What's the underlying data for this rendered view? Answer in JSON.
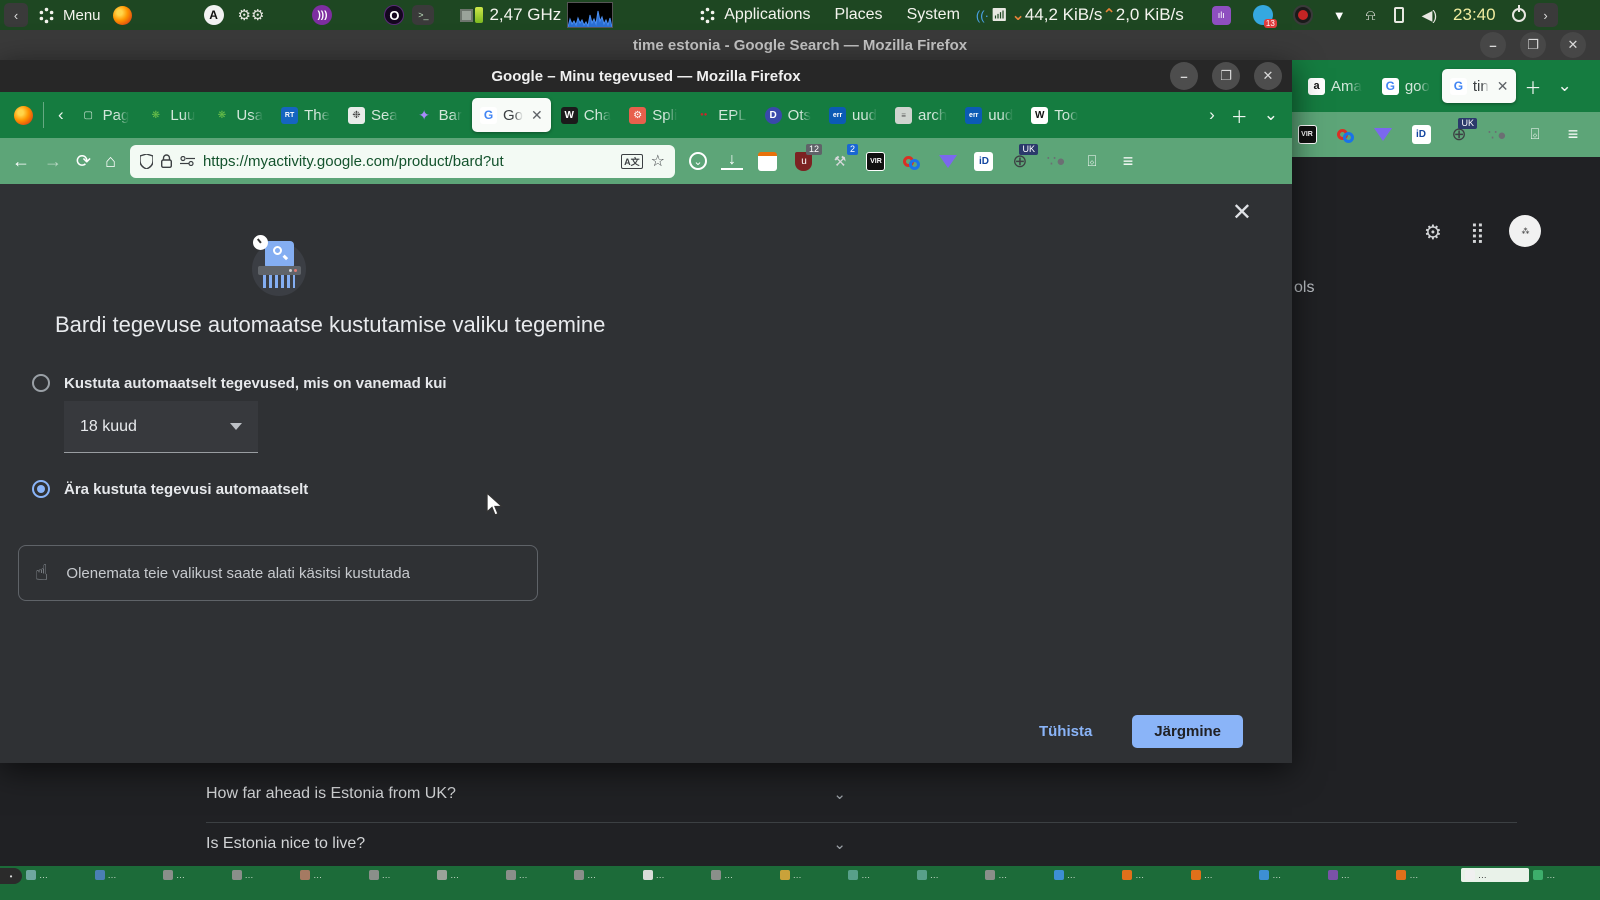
{
  "colors": {
    "accent_blue": "#8ab4f8",
    "panel_green": "#1e4722",
    "tab_green": "#157c40",
    "toolbar_green": "#5da578",
    "taskbar_green": "#1c6b39",
    "url_text_green": "#14532d"
  },
  "panel": {
    "menu_label": "Menu",
    "cpu_freq": "2,47 GHz",
    "menus": {
      "applications": "Applications",
      "places": "Places",
      "system": "System"
    },
    "net": {
      "down": "44,2 KiB/s",
      "up": "2,0 KiB/s"
    },
    "clock": "23:40",
    "tray_badge": "13"
  },
  "back_window": {
    "title": "time estonia - Google Search — Mozilla Firefox",
    "tabs": [
      {
        "label": "Ama",
        "icon": "amazon"
      },
      {
        "label": "goo",
        "icon": "google"
      },
      {
        "label": "tin",
        "icon": "google",
        "active": true
      }
    ],
    "page": {
      "tools_partial": "ols",
      "questions": [
        "How far ahead is Estonia from UK?",
        "Is Estonia nice to live?"
      ]
    }
  },
  "front_window": {
    "title": "Google – Minu tegevused — Mozilla Firefox",
    "tabs": [
      {
        "label": "Pag",
        "icon": "page"
      },
      {
        "label": "Luu",
        "icon": "pinwheel"
      },
      {
        "label": "Usa",
        "icon": "pinwheel"
      },
      {
        "label": "The",
        "icon": "rt"
      },
      {
        "label": "Sea",
        "icon": "openai"
      },
      {
        "label": "Bar",
        "icon": "bard"
      },
      {
        "label": "Go",
        "icon": "google",
        "active": true
      },
      {
        "label": "Cha",
        "icon": "wa"
      },
      {
        "label": "Spli",
        "icon": "wrench"
      },
      {
        "label": "EPL",
        "icon": "dots"
      },
      {
        "label": "Ots",
        "icon": "ddg"
      },
      {
        "label": "uud",
        "icon": "err"
      },
      {
        "label": "arch",
        "icon": "archive"
      },
      {
        "label": "uud",
        "icon": "err"
      },
      {
        "label": "Too",
        "icon": "wiki"
      }
    ],
    "urlbar": {
      "url": "https://myactivity.google.com/product/bard?ut"
    },
    "ext": {
      "ublock_badge": "12",
      "helper_badge": "2",
      "vir": "VIR",
      "id": "iD",
      "uk": "UK"
    },
    "dialog": {
      "title": "Bardi tegevuse automaatse kustutamise valiku tegemine",
      "option_auto": "Kustuta automaatselt tegevused, mis on vanemad kui",
      "dropdown_value": "18 kuud",
      "option_never": "Ära kustuta tegevusi automaatselt",
      "info": "Olenemata teie valikust saate alati käsitsi kustutada",
      "cancel_label": "Tühista",
      "next_label": "Järgmine"
    }
  },
  "icons": {
    "page": "▢",
    "pinwheel": "❋",
    "rt": "RT",
    "openai": "❉",
    "bard": "✦",
    "google": "G",
    "wa": "W",
    "wrench": "⚙",
    "dots": "●●",
    "ddg": "D",
    "err": "err",
    "archive": "≡",
    "wiki": "W",
    "amazon": "a"
  },
  "taskbar": {
    "items": [
      {
        "c": "#6fa7a0"
      },
      {
        "c": "#4a7fb5"
      },
      {
        "c": "#8a8f8a"
      },
      {
        "c": "#8a8f8a"
      },
      {
        "c": "#a57a62"
      },
      {
        "c": "#8a8f8a"
      },
      {
        "c": "#9aa39a"
      },
      {
        "c": "#8a8f8a"
      },
      {
        "c": "#8a8f8a"
      },
      {
        "c": "#d8dcd8"
      },
      {
        "c": "#8a8f8a"
      },
      {
        "c": "#c9a23a"
      },
      {
        "c": "#58a08a"
      },
      {
        "c": "#58a08a"
      },
      {
        "c": "#8a8f8a"
      },
      {
        "c": "#3d8fd4"
      },
      {
        "c": "#e0701a"
      },
      {
        "c": "#e0701a"
      },
      {
        "c": "#3d8fd4"
      },
      {
        "c": "#7a52a8"
      },
      {
        "c": "#e0701a"
      },
      {
        "c": "#f0f0f0",
        "active": true
      },
      {
        "c": "#3dae6b"
      }
    ],
    "item_label": "…"
  }
}
